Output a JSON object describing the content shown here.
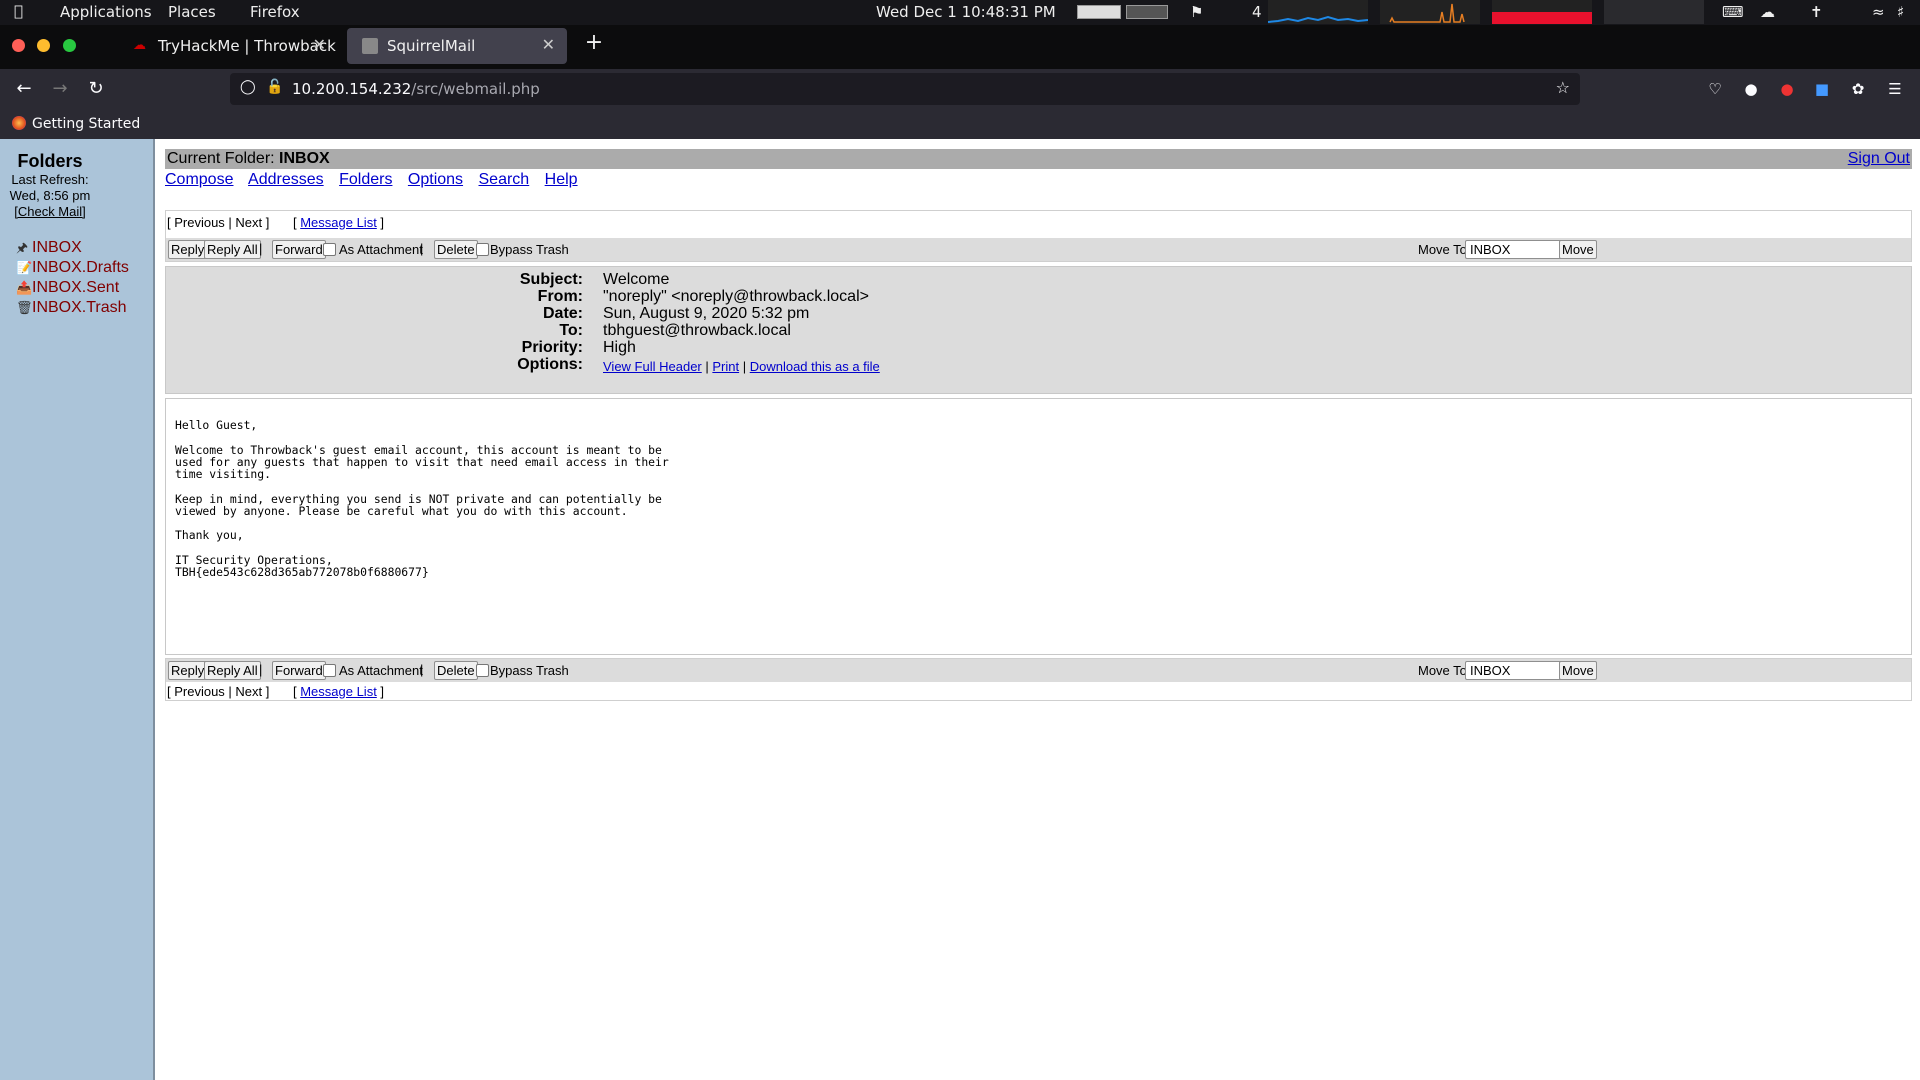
{
  "system_bar": {
    "applications": "Applications",
    "places": "Places",
    "firefox": "Firefox",
    "clock": "Wed Dec 1  10:48:31 PM",
    "workspace_count": "4"
  },
  "browser": {
    "tabs": [
      {
        "label": "TryHackMe | Throwback",
        "active": false
      },
      {
        "label": "SquirrelMail",
        "active": true
      }
    ],
    "url_host": "10.200.154.232",
    "url_path": "/src/webmail.php",
    "bookmark": "Getting Started"
  },
  "sidebar": {
    "title": "Folders",
    "last_refresh_label": "Last Refresh:",
    "last_refresh_value": "Wed, 8:56 pm",
    "check_mail": "[Check Mail]",
    "folders": [
      "INBOX",
      "INBOX.Drafts",
      "INBOX.Sent",
      "INBOX.Trash"
    ]
  },
  "main": {
    "current_folder_label": "Current Folder:",
    "current_folder": "INBOX",
    "sign_out": "Sign Out",
    "menu": [
      "Compose",
      "Addresses",
      "Folders",
      "Options",
      "Search",
      "Help"
    ],
    "nav": {
      "prev_next": "[ Previous | Next ]",
      "message_list": "Message List"
    },
    "actions": {
      "reply": "Reply",
      "reply_all": "Reply All",
      "forward": "Forward",
      "as_attachment": "As Attachment",
      "delete": "Delete",
      "bypass_trash": "Bypass Trash",
      "move_to_label": "Move To:",
      "move_to_value": "INBOX",
      "move": "Move"
    },
    "headers": {
      "subject_label": "Subject:",
      "subject": "Welcome",
      "from_label": "From:",
      "from": "\"noreply\" <noreply@throwback.local>",
      "date_label": "Date:",
      "date": "Sun, August 9, 2020 5:32 pm",
      "to_label": "To:",
      "to": "tbhguest@throwback.local",
      "priority_label": "Priority:",
      "priority": "High",
      "options_label": "Options:",
      "view_full_header": "View Full Header",
      "print": "Print",
      "download": "Download this as a file"
    },
    "body": "Hello Guest,\n\nWelcome to Throwback's guest email account, this account is meant to be\nused for any guests that happen to visit that need email access in their\ntime visiting.\n\nKeep in mind, everything you send is NOT private and can potentially be\nviewed by anyone. Please be careful what you do with this account.\n\nThank you,\n\nIT Security Operations,\nTBH{ede543c628d365ab772078b0f6880677}"
  }
}
